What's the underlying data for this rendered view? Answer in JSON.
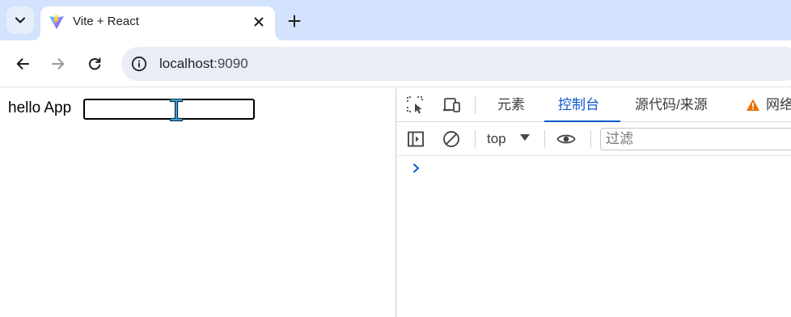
{
  "browser": {
    "tab": {
      "title": "Vite + React",
      "favicon": "vite-icon"
    },
    "address": {
      "host": "localhost",
      "port": ":9090",
      "icon": "info-icon"
    }
  },
  "page": {
    "text": "hello App",
    "input_value": ""
  },
  "devtools": {
    "tabs": [
      {
        "label": "元素"
      },
      {
        "label": "控制台",
        "active": true
      },
      {
        "label": "源代码/来源"
      },
      {
        "label": "网络",
        "icon": "warning-icon"
      }
    ],
    "context": "top",
    "filter_placeholder": "过滤"
  },
  "colors": {
    "accent": "#0b57d0",
    "tabstrip": "#d3e3fd",
    "omnibox": "#e9eef6"
  }
}
